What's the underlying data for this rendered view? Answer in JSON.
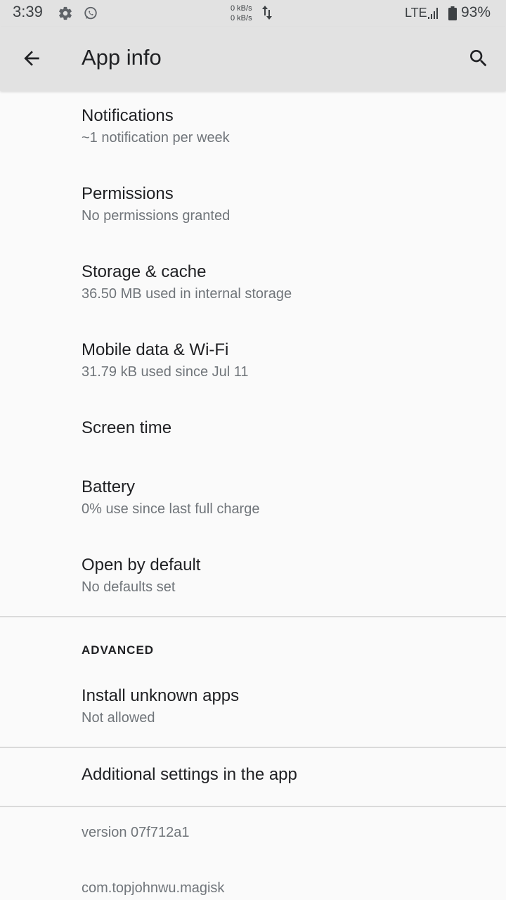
{
  "status_bar": {
    "time": "3:39",
    "net_up": "0 kB/s",
    "net_down": "0 kB/s",
    "network": "LTE",
    "battery": "93%",
    "icons": [
      "gear-icon",
      "whatsapp-icon",
      "data-arrows-icon",
      "signal-icon",
      "battery-icon"
    ]
  },
  "app_bar": {
    "title": "App info",
    "back_icon": "arrow-back-icon",
    "search_icon": "search-icon"
  },
  "items": [
    {
      "title": "Notifications",
      "subtitle": "~1 notification per week"
    },
    {
      "title": "Permissions",
      "subtitle": "No permissions granted"
    },
    {
      "title": "Storage & cache",
      "subtitle": "36.50 MB used in internal storage"
    },
    {
      "title": "Mobile data & Wi-Fi",
      "subtitle": "31.79 kB used since Jul 11"
    },
    {
      "title": "Screen time"
    },
    {
      "title": "Battery",
      "subtitle": "0% use since last full charge"
    },
    {
      "title": "Open by default",
      "subtitle": "No defaults set"
    }
  ],
  "advanced": {
    "header": "ADVANCED",
    "install_unknown": {
      "title": "Install unknown apps",
      "subtitle": "Not allowed"
    }
  },
  "additional_settings": "Additional settings in the app",
  "footer": {
    "version": "version 07f712a1",
    "package": "com.topjohnwu.magisk"
  }
}
